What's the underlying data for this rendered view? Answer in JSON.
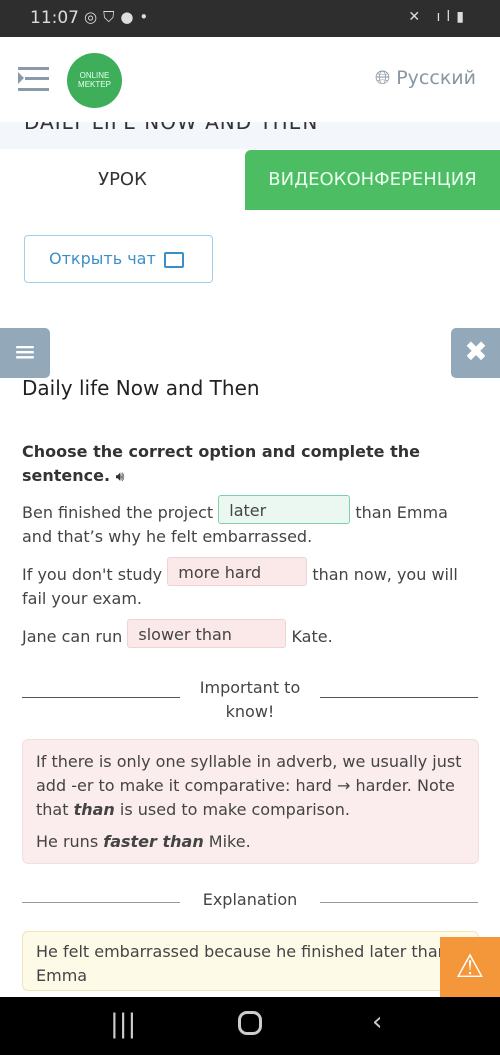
{
  "status_bar": {
    "time": "11:07",
    "left_icons": "whatsapp shield account dot",
    "right_icons": "mute 4g signal battery"
  },
  "header": {
    "logo": "ONLINE MEKTEP",
    "logo_line1": "ONLINE",
    "logo_line2": "MEKTEP",
    "language": "Русский"
  },
  "band_title": "DAILY LIFE NOW AND THEN",
  "tabs": [
    {
      "label": "УРОК",
      "active": true
    },
    {
      "label": "ВИДЕОКОНФЕРЕНЦИЯ",
      "active": false
    }
  ],
  "chat_button": "Открыть чат",
  "lesson": {
    "title": "Daily life Now and Then",
    "instruction": "Choose the correct option and complete the sentence.",
    "sentences": [
      {
        "before": "Ben finished the project",
        "answer": "later",
        "after": "than Emma and that’s why he felt embarrassed.",
        "status": "correct"
      },
      {
        "before": "If you don't study",
        "answer": "more hard",
        "after": "than now, you will fail your exam.",
        "status": "incorrect"
      },
      {
        "before": "Jane can run",
        "answer": "slower than",
        "after": "Kate.",
        "status": "incorrect"
      }
    ],
    "important_heading": "Important to know!",
    "important_heading_1": "Important to",
    "important_heading_2": "know!",
    "note": {
      "p1_a": "If there is only one syllable in adverb, we usually just add -er to make it comparative: hard → harder. Note that ",
      "p1_b": "than",
      "p1_c": " is used to make comparison.",
      "p2_a": "He runs ",
      "p2_b": "faster than",
      "p2_c": " Mike."
    },
    "explanation_heading": "Explanation",
    "explanation": "He felt embarrassed because he finished later than Emma"
  },
  "colors": {
    "accent_green": "#4cbd63",
    "correct_bg": "#eaf8f1",
    "incorrect_bg": "#fbe9ea",
    "warning": "#f3973a"
  }
}
